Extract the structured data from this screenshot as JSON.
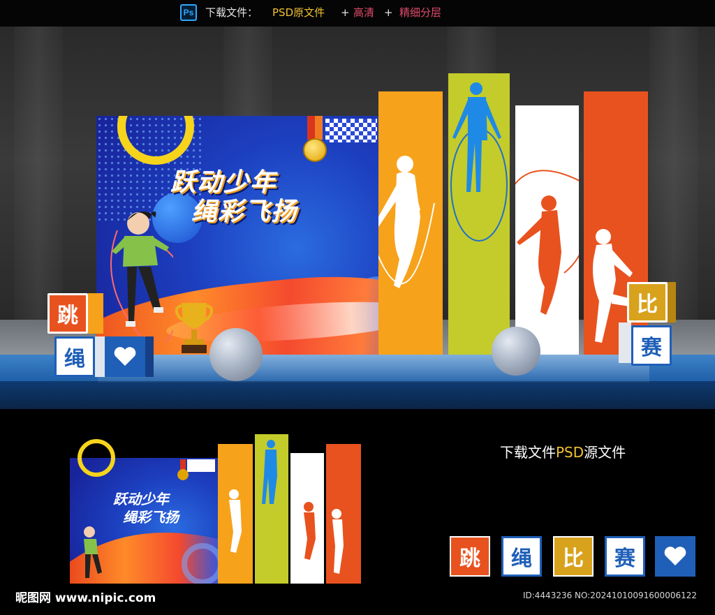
{
  "topbar": {
    "ps_icon": "Ps",
    "label": "下载文件：",
    "psd": "PSD原文件",
    "plus1": "+",
    "hd": "高清",
    "plus2": "+",
    "layered": "精细分层"
  },
  "board": {
    "title_line1": "跃动少年",
    "title_line2": "绳彩飞扬"
  },
  "cubes": {
    "left_top": "跳",
    "left_bottom": "绳",
    "right_top": "比",
    "right_bottom": "赛"
  },
  "lower": {
    "thumb_title_line1": "跃动少年",
    "thumb_title_line2": "绳彩飞扬",
    "right_title_prefix": "下载文件",
    "right_title_psd": "PSD",
    "right_title_suffix": "源文件",
    "icons": [
      "跳",
      "绳",
      "比",
      "赛",
      "heart-icon"
    ],
    "brand": "昵图网 www.nipic.com",
    "id_text": "ID:4443236 NO:20241010091600006122"
  },
  "colors": {
    "orange": "#f7a21b",
    "lime": "#c3cc2a",
    "white": "#ffffff",
    "red_orange": "#e8521f",
    "blue": "#1f5fb8",
    "gold": "#d9a21c"
  }
}
